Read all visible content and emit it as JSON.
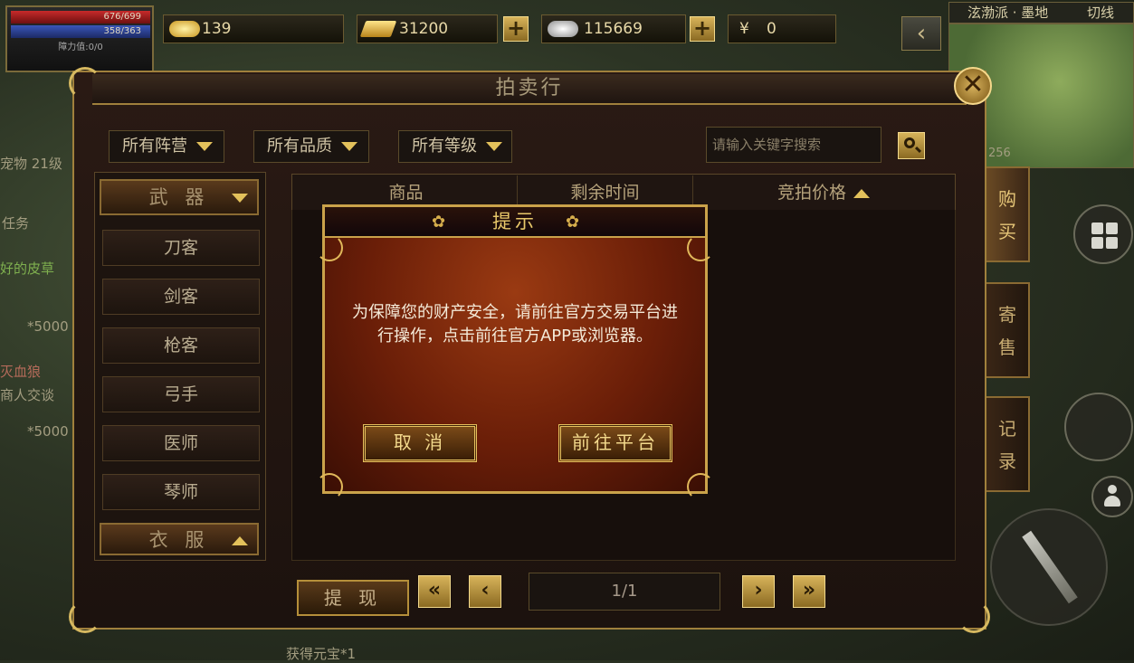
{
  "hud": {
    "hp": "676/699",
    "mp": "358/363",
    "obstacle": "障力值:0/0",
    "gold_ingot": "139",
    "gold_bar": "31200",
    "silver": "115669",
    "yuan_symbol": "¥",
    "yuan": "0",
    "plus": "+",
    "region": "泫渤派 · 墨地",
    "switch_line": "切线"
  },
  "background_text": {
    "level": "宠物 21级",
    "task": "任务",
    "skin": "好的皮草",
    "count1": "*5000",
    "wolf": "灭血狼",
    "trade": "商人交谈",
    "count2": "*5000",
    "log": "获得元宝*1",
    "minimap_level": "256"
  },
  "auction": {
    "title": "拍卖行",
    "close_glyph": "✕",
    "filters": [
      "所有阵营",
      "所有品质",
      "所有等级"
    ],
    "search_placeholder": "请输入关键字搜索",
    "categories": {
      "weapon_header": "武 器",
      "items": [
        "刀客",
        "剑客",
        "枪客",
        "弓手",
        "医师",
        "琴师"
      ],
      "clothes_header": "衣 服"
    },
    "columns": [
      "商品",
      "剩余时间",
      "竞拍价格"
    ],
    "withdraw": "提 现",
    "page_first": "«",
    "page_prev": "‹",
    "page_next": "›",
    "page_last": "»",
    "page_indicator": "1/1",
    "side_tabs": [
      {
        "c1": "购",
        "c2": "买"
      },
      {
        "c1": "寄",
        "c2": "售"
      },
      {
        "c1": "记",
        "c2": "录"
      }
    ]
  },
  "modal": {
    "title": "提示",
    "message": "为保障您的财产安全，请前往官方交易平台进行操作，点击前往官方APP或浏览器。",
    "cancel": "取 消",
    "go": "前往平台"
  },
  "colors": {
    "gold": "#caa24a",
    "modal_bg": "#6a1e08",
    "panel_bg": "#1f1511"
  }
}
